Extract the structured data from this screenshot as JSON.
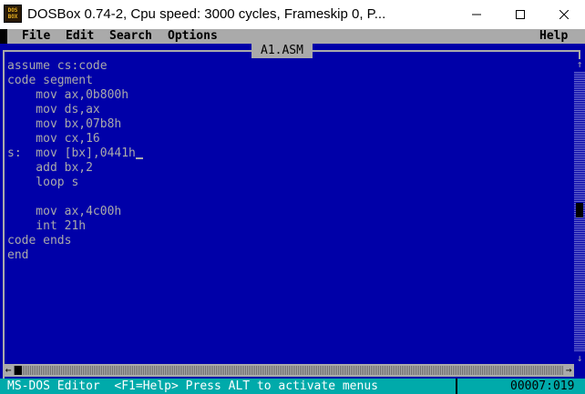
{
  "window": {
    "title": "DOSBox 0.74-2, Cpu speed:     3000 cycles, Frameskip  0, P...",
    "icon_text_line1": "DOS",
    "icon_text_line2": "BOX",
    "icon": "dosbox-icon",
    "controls": [
      "minimize-icon",
      "maximize-icon",
      "close-icon"
    ]
  },
  "menubar": {
    "file": "File",
    "edit": "Edit",
    "search": "Search",
    "options": "Options",
    "help": "Help"
  },
  "editor": {
    "filename": "A1.ASM",
    "lines": [
      "assume cs:code",
      "code segment",
      "    mov ax,0b800h",
      "    mov ds,ax",
      "    mov bx,07b8h",
      "    mov cx,16",
      "s:  mov [bx],0441h",
      "    add bx,2",
      "    loop s",
      "",
      "    mov ax,4c00h",
      "    int 21h",
      "code ends",
      "end"
    ]
  },
  "scroll": {
    "up_arrow": "↑",
    "down_arrow": "↓",
    "left_arrow": "←",
    "right_arrow": "→"
  },
  "status": {
    "text": "MS-DOS Editor  <F1=Help> Press ALT to activate menus",
    "position": "00007:019"
  },
  "colors": {
    "background": "#0000a8",
    "menubar": "#aaaaaa",
    "statusbar": "#00aaaa",
    "text": "#aaaaaa"
  }
}
